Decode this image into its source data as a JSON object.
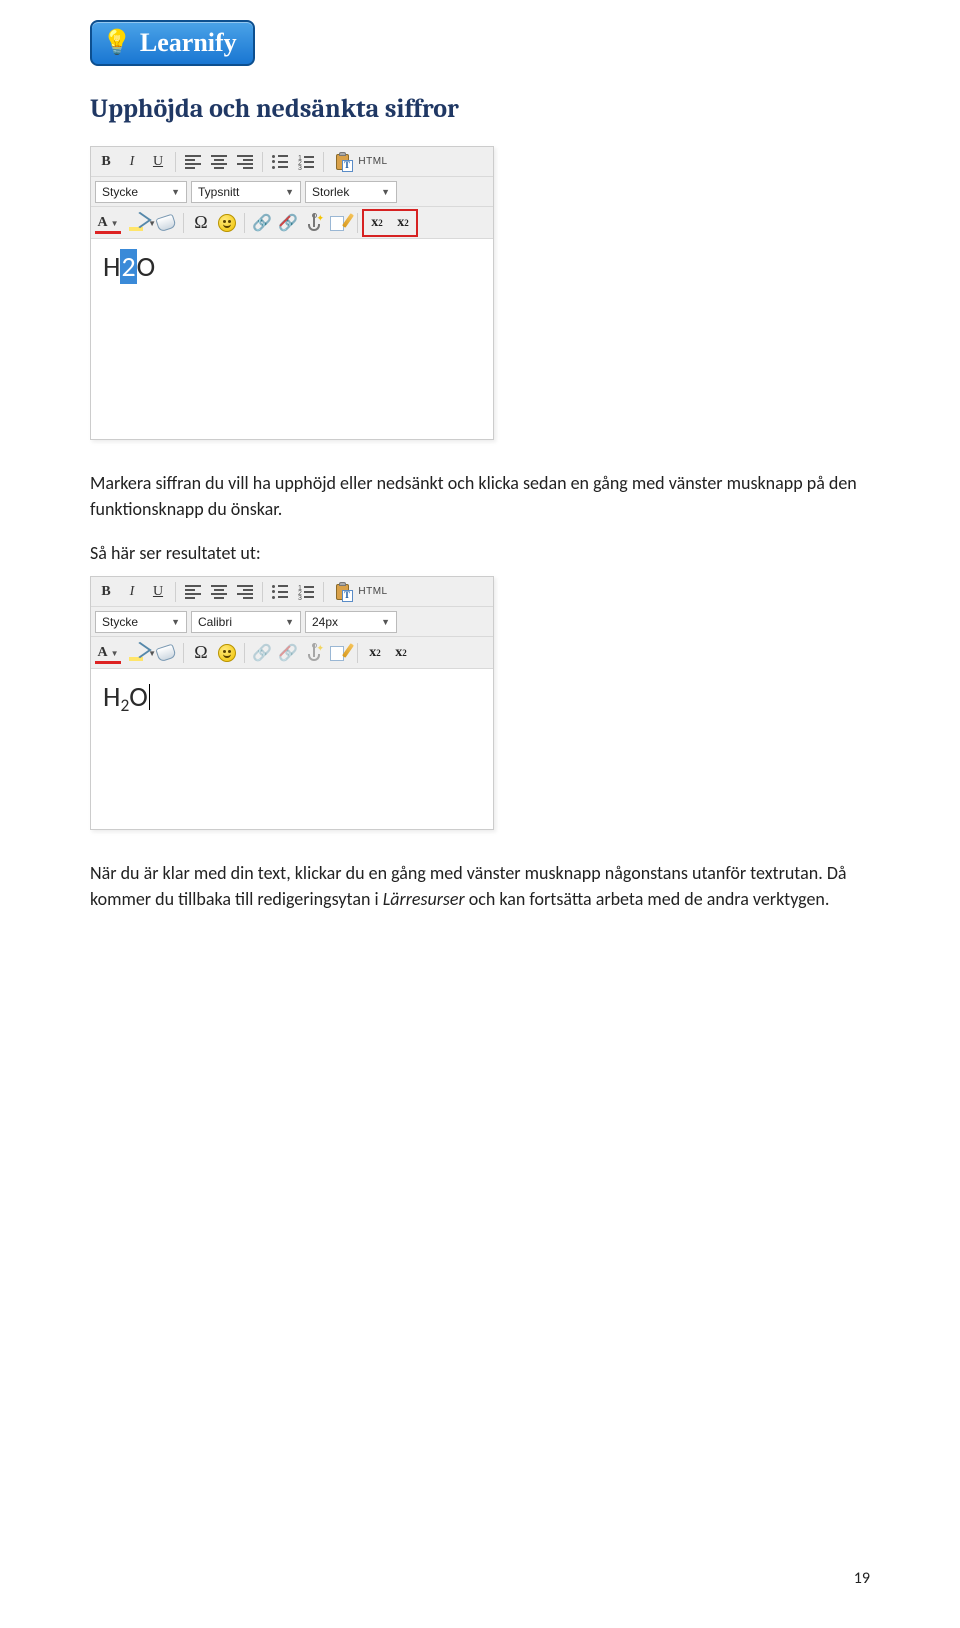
{
  "logo": {
    "brand": "Learnify"
  },
  "heading": "Upphöjda och nedsänkta siffror",
  "paragraph1": "Markera siffran du vill ha upphöjd eller nedsänkt och klicka sedan en gång med vänster musknapp på den funktionsknapp du önskar.",
  "paragraph2": "Så här ser resultatet ut:",
  "paragraph3_a": "När du är klar med din text, klickar du en gång med vänster musknapp någonstans utanför textrutan. Då kommer du tillbaka till redigeringsytan i ",
  "paragraph3_source": "Lärresurser",
  "paragraph3_b": " och kan fortsätta arbeta med de andra verktygen.",
  "editor1": {
    "row1": {
      "bold": "B",
      "italic": "I",
      "underline": "U",
      "html": "HTML"
    },
    "row2": {
      "stycke": "Stycke",
      "typsnitt": "Typsnitt",
      "storlek": "Storlek"
    },
    "row3": {
      "letterA": "A",
      "omega": "Ω",
      "sup": "x",
      "sup_exp": "2",
      "sub": "x",
      "sub_exp": "2"
    },
    "content": {
      "h": "H",
      "two": "2",
      "o": "O"
    }
  },
  "editor2": {
    "row1": {
      "bold": "B",
      "italic": "I",
      "underline": "U",
      "html": "HTML"
    },
    "row2": {
      "stycke": "Stycke",
      "typsnitt": "Calibri",
      "storlek": "24px"
    },
    "row3": {
      "letterA": "A",
      "omega": "Ω",
      "sup": "x",
      "sup_exp": "2",
      "sub": "x",
      "sub_exp": "2"
    },
    "content": {
      "h": "H",
      "two": "2",
      "o": "O"
    }
  },
  "pageNumber": "19"
}
